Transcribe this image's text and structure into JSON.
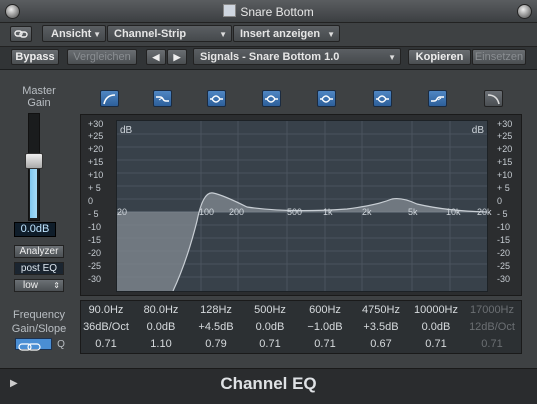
{
  "window": {
    "title": "Snare Bottom"
  },
  "toolbar1": {
    "view_label": "Ansicht",
    "channel_strip_label": "Channel-Strip anzeigen",
    "insert_label": "Insert anzeigen"
  },
  "toolbar2": {
    "bypass_label": "Bypass",
    "compare_label": "Vergleichen",
    "prev_label": "◀",
    "next_label": "▶",
    "preset_label": "Signals - Snare Bottom 1.0",
    "copy_label": "Kopieren",
    "paste_label": "Einsetzen"
  },
  "left": {
    "master_label": "Master",
    "gain_label": "Gain",
    "gain_value": "0.0dB",
    "master_gain_db": 0.0,
    "analyzer_label": "Analyzer",
    "post_label": "post EQ",
    "resolution_label": "low",
    "frequency_label": "Frequency",
    "gainslope_label": "Gain/Slope",
    "q_label": "Q"
  },
  "graph": {
    "db_label": "dB",
    "left_ticks": [
      "+30",
      "+25",
      "+20",
      "+15",
      "+10",
      "+ 5",
      "0",
      "- 5",
      "-10",
      "-15",
      "-20",
      "-25",
      "-30"
    ],
    "right_ticks": [
      "+30",
      "+25",
      "+20",
      "+15",
      "+10",
      "+ 5",
      "0",
      "- 5",
      "-10",
      "-15",
      "-20",
      "-25",
      "-30"
    ],
    "freq_labels": [
      "20",
      "100",
      "200",
      "500",
      "1k",
      "2k",
      "5k",
      "10k",
      "20k"
    ]
  },
  "bands": {
    "frequency": [
      "90.0Hz",
      "80.0Hz",
      "128Hz",
      "500Hz",
      "600Hz",
      "4750Hz",
      "10000Hz",
      "17000Hz"
    ],
    "gain_slope": [
      "36dB/Oct",
      "0.0dB",
      "+4.5dB",
      "0.0dB",
      "−1.0dB",
      "+3.5dB",
      "0.0dB",
      "12dB/Oct"
    ],
    "q": [
      "0.71",
      "1.10",
      "0.79",
      "0.71",
      "0.71",
      "0.67",
      "0.71",
      "0.71"
    ],
    "enabled": [
      true,
      true,
      true,
      true,
      true,
      true,
      true,
      false
    ]
  },
  "footer": {
    "plugin_name": "Channel EQ"
  }
}
